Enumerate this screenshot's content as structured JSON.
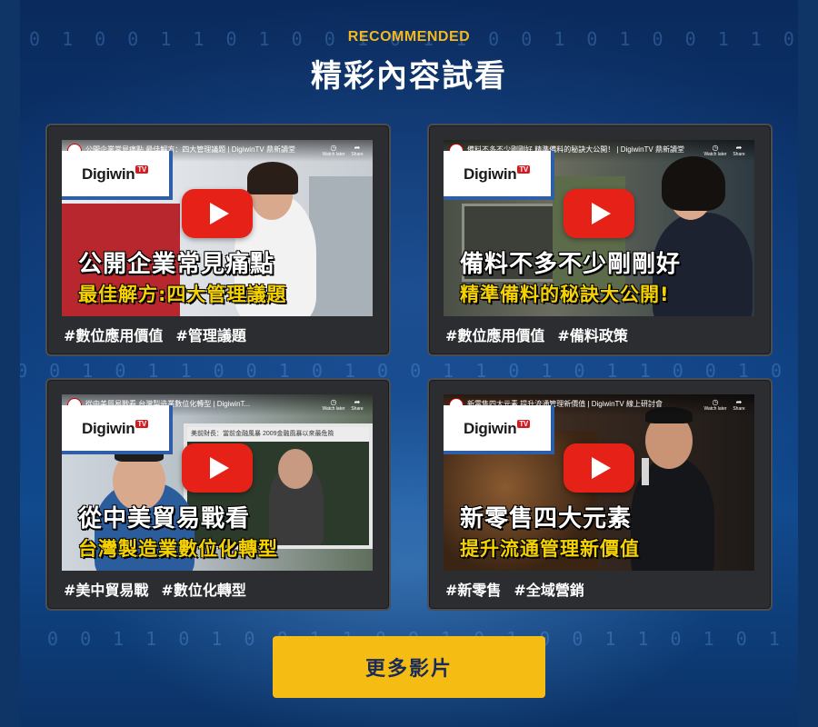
{
  "header": {
    "eyebrow": "RECOMMENDED",
    "title": "精彩內容試看"
  },
  "background_digits": [
    "0 1 0 0 1 1 0 1 0 0 1 0 1 1 0 0 1 0 1 0 0 1 1 0 1 0 0 1",
    "1 0 0 1 0 1 1 0 0 1 0 1 0 0 1 1 0 1 0 1 1 0 0 1 0 1 1 0",
    "0 0 1 1 0 1 0 0 1 1 0 0 1 0 1 0 0 1 1 0 1 0 1 0 0 1 0 1"
  ],
  "colors": {
    "accent": "#f5b81c",
    "button_bg": "#f5bd14",
    "button_text": "#1a2b57",
    "card_bg": "#2b2d31",
    "caption_yellow": "#f6d300",
    "youtube_red": "#e62117"
  },
  "videos": [
    {
      "video_title": "公開企業常見痛點 最佳解方：四大管理議題 | DigiwinTV 鼎新讀堂",
      "brand": "Digiwin",
      "brand_tv": "TV",
      "caption_line1": "公開企業常見痛點",
      "caption_line2": "最佳解方:四大管理議題",
      "tags": [
        "#數位應用價值",
        "#管理議題"
      ],
      "watch_later": "Watch later",
      "share": "Share"
    },
    {
      "video_title": "備料不多不少剛剛好 精準備料的秘訣大公開！ | DigiwinTV 鼎新讀堂",
      "brand": "Digiwin",
      "brand_tv": "TV",
      "caption_line1": "備料不多不少剛剛好",
      "caption_line2": "精準備料的秘訣大公開!",
      "tags": [
        "#數位應用價值",
        "#備料政策"
      ],
      "watch_later": "Watch later",
      "share": "Share"
    },
    {
      "video_title": "從中美貿易戰看 台灣製造業數位化轉型 | DigiwinT...",
      "brand": "Digiwin",
      "brand_tv": "TV",
      "inset_text": "美前財長：當前金融風暴 2009金融風暴以來最危險",
      "caption_line1": "從中美貿易戰看",
      "caption_line2": "台灣製造業數位化轉型",
      "tags": [
        "#美中貿易戰",
        "#數位化轉型"
      ],
      "watch_later": "Watch later",
      "share": "Share"
    },
    {
      "video_title": "新零售四大元素 提升流通管理新價值 | DigiwinTV 線上研討會",
      "brand": "Digiwin",
      "brand_tv": "TV",
      "caption_line1": "新零售四大元素",
      "caption_line2": "提升流通管理新價值",
      "tags": [
        "#新零售",
        "#全域營銷"
      ],
      "watch_later": "Watch later",
      "share": "Share"
    }
  ],
  "more_button": "更多影片"
}
